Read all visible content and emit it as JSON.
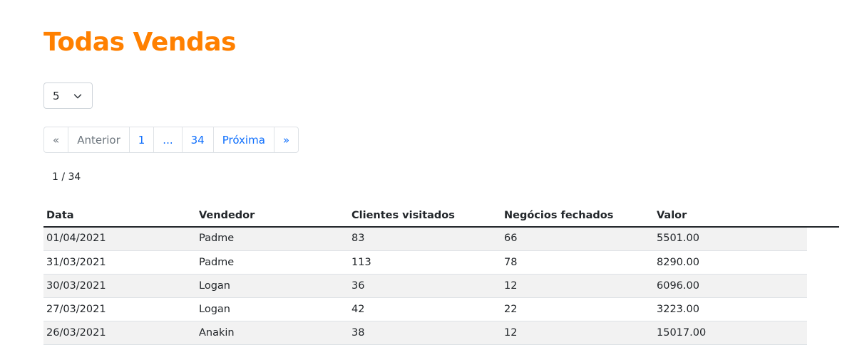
{
  "page": {
    "title": "Todas Vendas"
  },
  "page_size": {
    "selected": "5"
  },
  "pagination": {
    "first": "«",
    "previous": "Anterior",
    "page_first": "1",
    "ellipsis": "...",
    "page_last": "34",
    "next": "Próxima",
    "last": "»"
  },
  "page_info": "1 / 34",
  "table": {
    "columns": [
      "Data",
      "Vendedor",
      "Clientes visitados",
      "Negócios fechados",
      "Valor"
    ],
    "rows": [
      [
        "01/04/2021",
        "Padme",
        "83",
        "66",
        "5501.00"
      ],
      [
        "31/03/2021",
        "Padme",
        "113",
        "78",
        "8290.00"
      ],
      [
        "30/03/2021",
        "Logan",
        "36",
        "12",
        "6096.00"
      ],
      [
        "27/03/2021",
        "Logan",
        "42",
        "22",
        "3223.00"
      ],
      [
        "26/03/2021",
        "Anakin",
        "38",
        "12",
        "15017.00"
      ]
    ]
  }
}
